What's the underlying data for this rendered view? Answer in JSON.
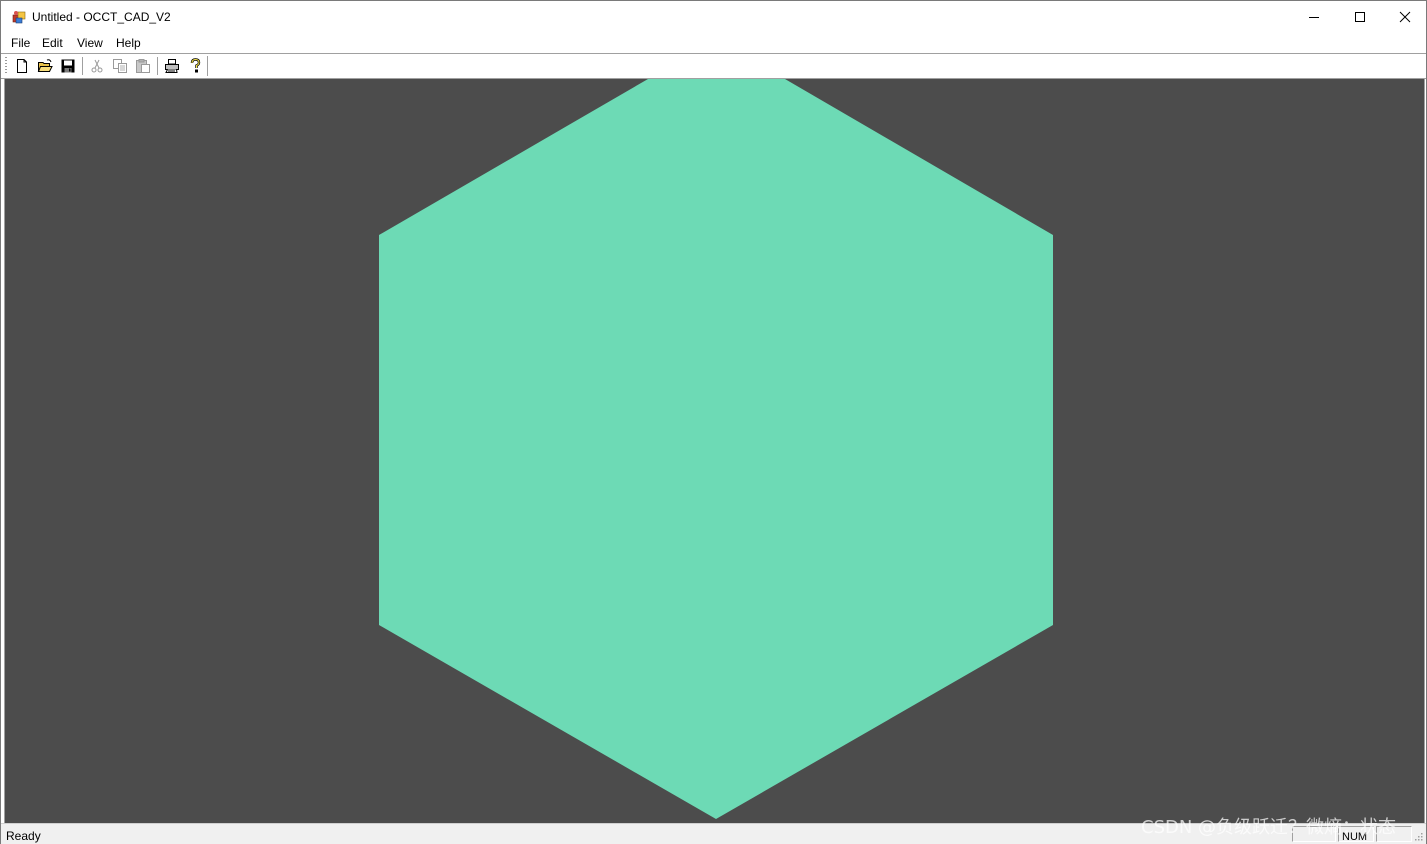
{
  "window": {
    "title": "Untitled - OCCT_CAD_V2"
  },
  "menu": {
    "items": [
      "File",
      "Edit",
      "View",
      "Help"
    ]
  },
  "toolbar": {
    "buttons": [
      {
        "name": "new-icon",
        "enabled": true
      },
      {
        "name": "open-icon",
        "enabled": true
      },
      {
        "name": "save-icon",
        "enabled": true
      },
      {
        "name": "cut-icon",
        "enabled": false
      },
      {
        "name": "copy-icon",
        "enabled": false
      },
      {
        "name": "paste-icon",
        "enabled": false
      },
      {
        "name": "print-icon",
        "enabled": true
      },
      {
        "name": "help-icon",
        "enabled": true
      }
    ]
  },
  "viewport": {
    "background_color": "#4c4c4c",
    "shape": {
      "type": "hexagon",
      "fill_color": "#6ddab5"
    }
  },
  "status": {
    "text": "Ready",
    "panes": [
      "",
      "NUM",
      ""
    ]
  },
  "watermark": {
    "text": "CSDN @负级跃迁？微熵：状态"
  }
}
